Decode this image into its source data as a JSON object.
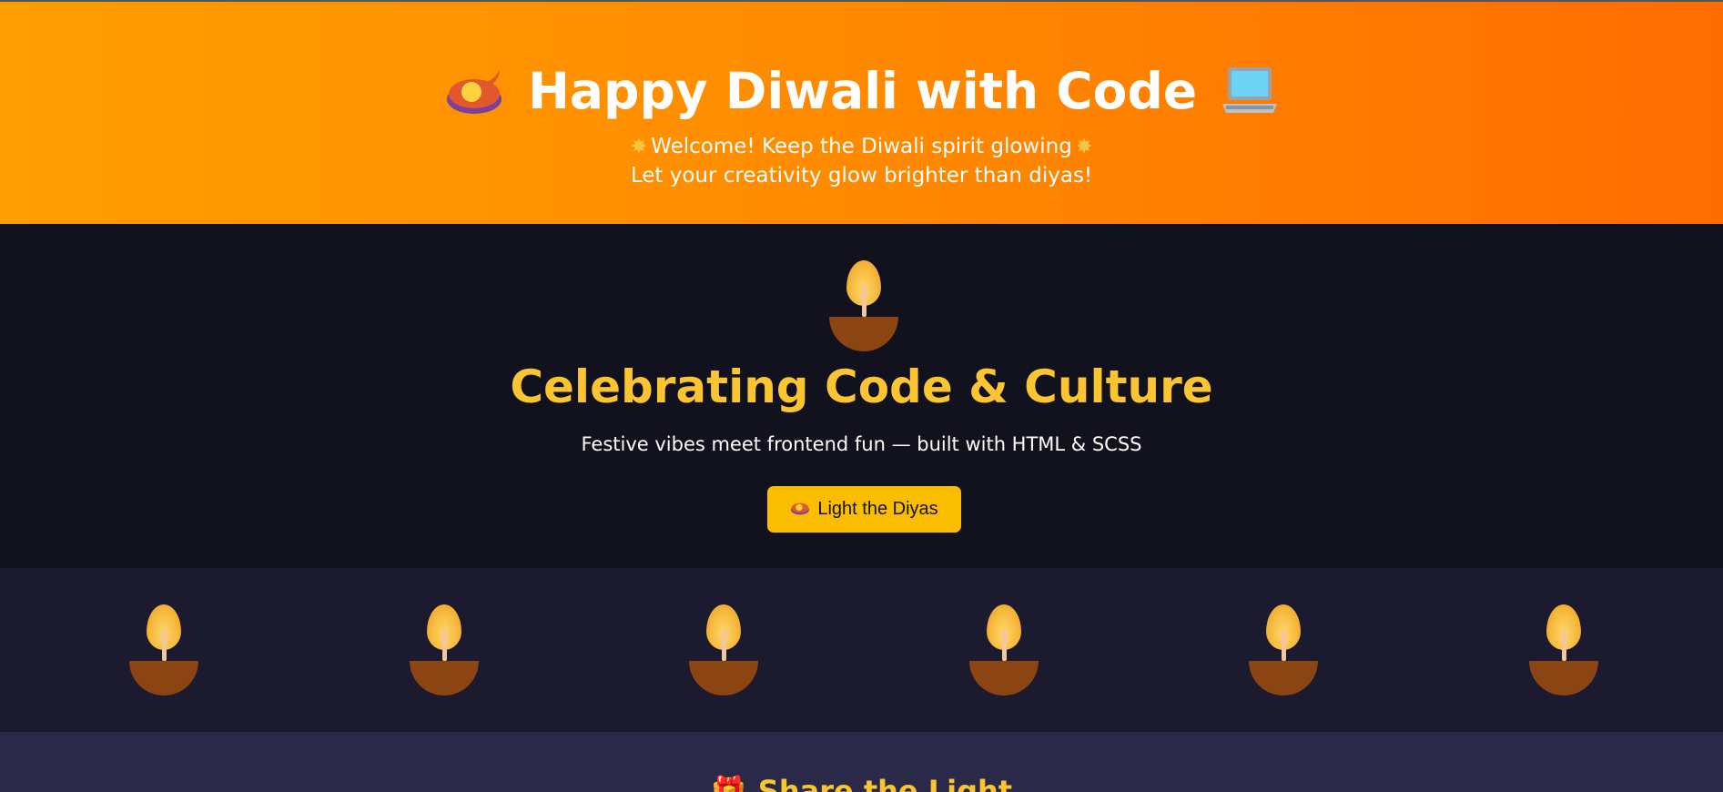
{
  "header": {
    "title": "Happy Diwali with Code",
    "leading_icon": "diya-lamp-icon",
    "trailing_icon": "laptop-icon",
    "welcome": "Welcome! Keep the Diwali spirit glowing",
    "welcome_icon": "sparkle-icon",
    "tagline": "Let your creativity glow brighter than diyas!",
    "gradient_colors": [
      "#ff9e00",
      "#ff6d00"
    ]
  },
  "hero": {
    "title": "Celebrating Code & Culture",
    "subtitle": "Festive vibes meet frontend fun — built with HTML & SCSS",
    "button_label": "Light the Diyas",
    "button_icon": "diya-lamp-icon",
    "accent_color": "#fbc531",
    "button_color": "#fbbd00"
  },
  "diya_row": {
    "count": 6,
    "flame_color": "#f6b93b",
    "bowl_color": "#8b4513"
  },
  "share": {
    "title": "Share the Light",
    "icon": "gift-icon"
  }
}
